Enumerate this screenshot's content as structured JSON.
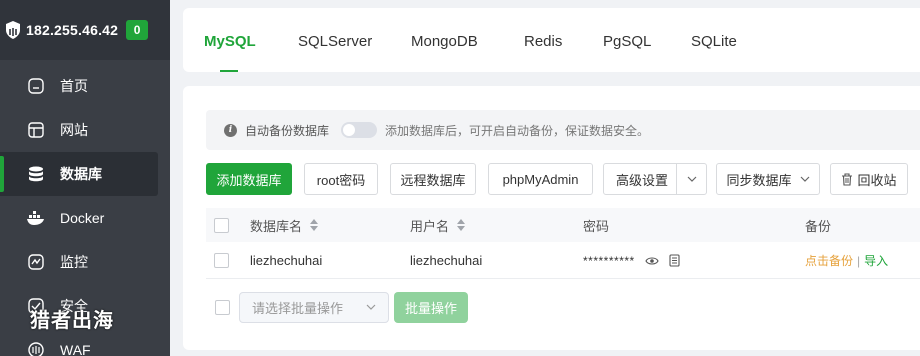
{
  "server": {
    "ip": "182.255.46.42",
    "badge": "0"
  },
  "sidebar": {
    "items": [
      {
        "label": "首页",
        "icon": "home-icon"
      },
      {
        "label": "网站",
        "icon": "website-icon"
      },
      {
        "label": "数据库",
        "icon": "database-icon",
        "active": true
      },
      {
        "label": "Docker",
        "icon": "docker-icon"
      },
      {
        "label": "监控",
        "icon": "monitor-icon"
      },
      {
        "label": "安全",
        "icon": "security-icon"
      },
      {
        "label": "WAF",
        "icon": "waf-icon"
      }
    ]
  },
  "watermark": "猎者出海",
  "tabs": [
    "MySQL",
    "SQLServer",
    "MongoDB",
    "Redis",
    "PgSQL",
    "SQLite"
  ],
  "info": {
    "label": "自动备份数据库",
    "desc": "添加数据库后，可开启自动备份，保证数据安全。"
  },
  "toolbar": {
    "add": "添加数据库",
    "root_pwd": "root密码",
    "remote": "远程数据库",
    "phpmyadmin": "phpMyAdmin",
    "advanced": "高级设置",
    "sync": "同步数据库",
    "recycle": "回收站"
  },
  "table": {
    "headers": {
      "name": "数据库名",
      "user": "用户名",
      "password": "密码",
      "backup": "备份"
    },
    "rows": [
      {
        "name": "liezhechuhai",
        "user": "liezhechuhai",
        "password": "**********",
        "backup_link": "点击备份",
        "import_link": "导入"
      }
    ]
  },
  "batch": {
    "placeholder": "请选择批量操作",
    "button": "批量操作"
  },
  "colors": {
    "accent": "#20a53a",
    "sidebar": "#3a3e45",
    "warning": "#e6a23c"
  }
}
